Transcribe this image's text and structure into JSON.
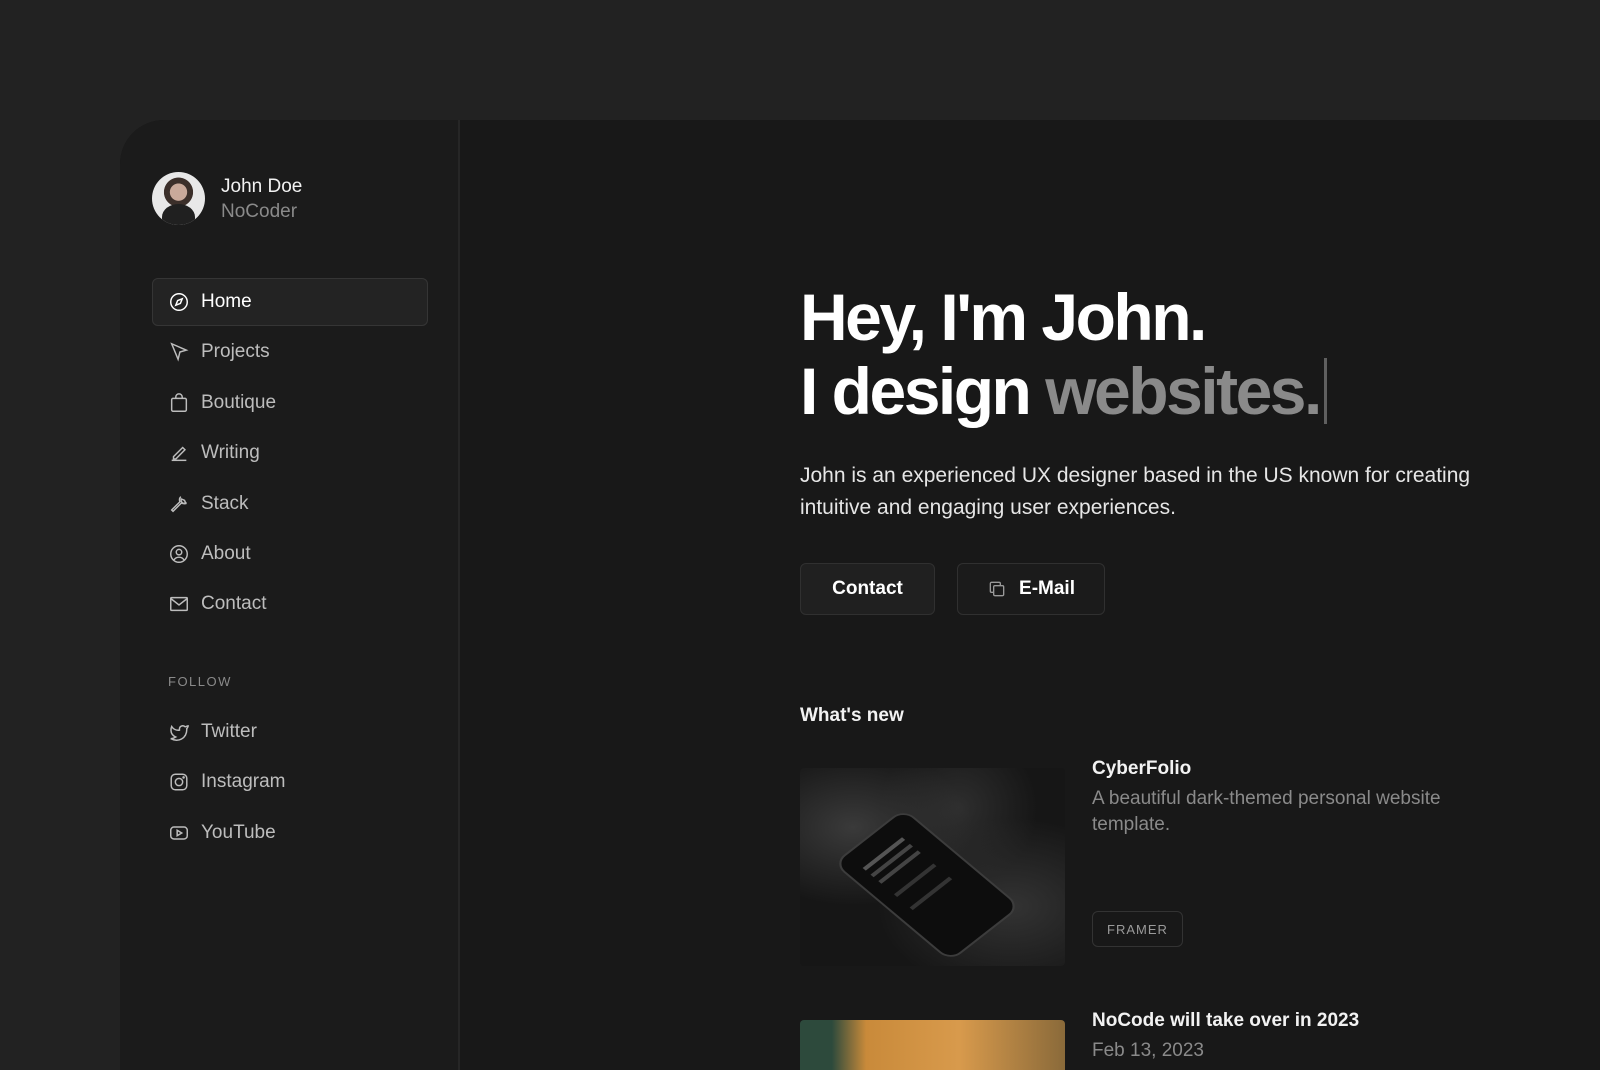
{
  "profile": {
    "name": "John Doe",
    "role": "NoCoder"
  },
  "nav": {
    "items": [
      {
        "label": "Home",
        "icon": "compass-icon",
        "active": true
      },
      {
        "label": "Projects",
        "icon": "pointer-icon"
      },
      {
        "label": "Boutique",
        "icon": "bag-icon"
      },
      {
        "label": "Writing",
        "icon": "pen-icon"
      },
      {
        "label": "Stack",
        "icon": "wrench-icon"
      },
      {
        "label": "About",
        "icon": "user-circle-icon"
      },
      {
        "label": "Contact",
        "icon": "mail-icon"
      }
    ]
  },
  "follow": {
    "label": "FOLLOW",
    "items": [
      {
        "label": "Twitter",
        "icon": "twitter-icon"
      },
      {
        "label": "Instagram",
        "icon": "instagram-icon"
      },
      {
        "label": "YouTube",
        "icon": "youtube-icon"
      }
    ]
  },
  "hero": {
    "line1": "Hey, I'm John.",
    "line2_start": "I design",
    "line2_muted": "websites.",
    "intro": "John is an experienced UX designer based in the US known for creating intuitive and engaging user experiences."
  },
  "buttons": {
    "contact": "Contact",
    "email": "E-Mail"
  },
  "whats_new": {
    "heading": "What's new",
    "items": [
      {
        "title": "CyberFolio",
        "description": "A beautiful dark-themed personal website template.",
        "tag": "FRAMER"
      },
      {
        "title": "NoCode will take over in 2023",
        "description": "Feb 13, 2023"
      }
    ]
  }
}
